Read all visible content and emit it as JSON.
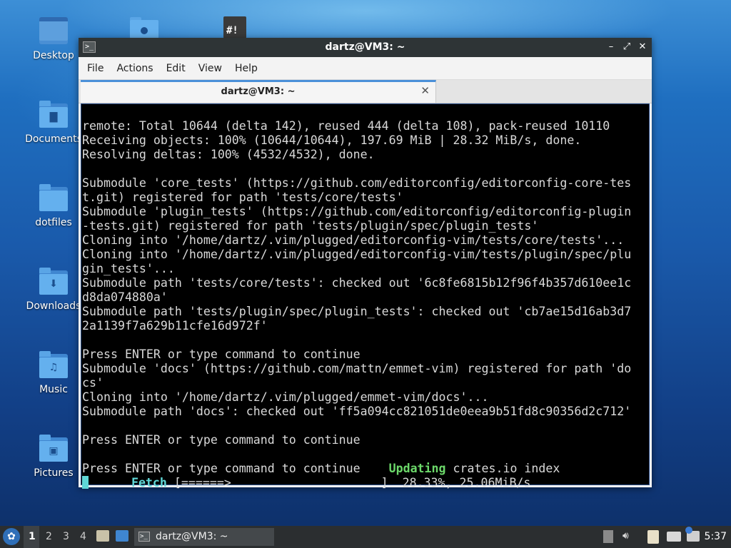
{
  "desktop": {
    "icons": [
      {
        "label": "Desktop",
        "icon": "desktop-folder-icon",
        "symbol": ""
      },
      {
        "label": "Documents",
        "icon": "documents-folder-icon",
        "symbol": "▇"
      },
      {
        "label": "dotfiles",
        "icon": "folder-icon",
        "symbol": ""
      },
      {
        "label": "Downloads",
        "icon": "downloads-folder-icon",
        "symbol": "⬇"
      },
      {
        "label": "Music",
        "icon": "music-folder-icon",
        "symbol": "♫"
      },
      {
        "label": "Pictures",
        "icon": "pictures-folder-icon",
        "symbol": "▣"
      }
    ]
  },
  "window": {
    "title": "dartz@VM3: ~",
    "controls": {
      "minimize": "–",
      "maximize": "⤢",
      "close": "✕"
    },
    "menu": [
      "File",
      "Actions",
      "Edit",
      "View",
      "Help"
    ],
    "tab": {
      "title": "dartz@VM3: ~",
      "close": "✕"
    },
    "terminal": {
      "lines": [
        "remote: Total 10644 (delta 142), reused 444 (delta 108), pack-reused 10110",
        "Receiving objects: 100% (10644/10644), 197.69 MiB | 28.32 MiB/s, done.",
        "Resolving deltas: 100% (4532/4532), done.",
        "",
        "Submodule 'core_tests' (https://github.com/editorconfig/editorconfig-core-tes",
        "t.git) registered for path 'tests/core/tests'",
        "Submodule 'plugin_tests' (https://github.com/editorconfig/editorconfig-plugin",
        "-tests.git) registered for path 'tests/plugin/spec/plugin_tests'",
        "Cloning into '/home/dartz/.vim/plugged/editorconfig-vim/tests/core/tests'...",
        "Cloning into '/home/dartz/.vim/plugged/editorconfig-vim/tests/plugin/spec/plu",
        "gin_tests'...",
        "Submodule path 'tests/core/tests': checked out '6c8fe6815b12f96f4b357d610ee1c",
        "d8da074880a'",
        "Submodule path 'tests/plugin/spec/plugin_tests': checked out 'cb7ae15d16ab3d7",
        "2a1139f7a629b11cfe16d972f'",
        "",
        "Press ENTER or type command to continue",
        "Submodule 'docs' (https://github.com/mattn/emmet-vim) registered for path 'do",
        "cs'",
        "Cloning into '/home/dartz/.vim/plugged/emmet-vim/docs'...",
        "Submodule path 'docs': checked out 'ff5a094cc821051de0eea9b51fd8c90356d2c712'",
        "",
        "Press ENTER or type command to continue",
        ""
      ],
      "line_prompt": "Press ENTER or type command to continue    ",
      "updating_word": "Updating",
      "updating_rest": " crates.io index",
      "fetch_word": "Fetch",
      "fetch_bar": " [======>                     ]  28.33%, 25.06MiB/s"
    }
  },
  "taskbar": {
    "workspaces": [
      "1",
      "2",
      "3",
      "4"
    ],
    "task": {
      "label": "dartz@VM3: ~"
    },
    "clock": "5:37",
    "tray_icons": [
      "upload-icon",
      "volume-icon",
      "clipboard-icon",
      "network-icon",
      "update-notification-icon"
    ]
  }
}
